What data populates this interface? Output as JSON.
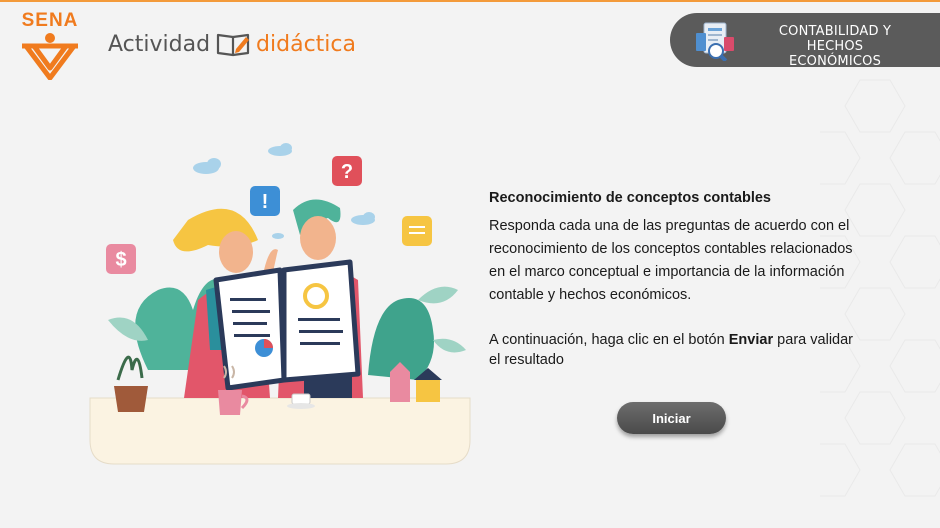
{
  "header": {
    "logo_text": "SENA",
    "brand_part1": "Actividad",
    "brand_part2": "didáctica",
    "module_title_line1": "CONTABILIDAD Y",
    "module_title_line2": "HECHOS ECONÓMICOS"
  },
  "activity": {
    "title": "Reconocimiento de conceptos contables",
    "instructions": "Responda cada una de las preguntas de acuerdo con el reconocimiento de los conceptos contables relacionados en el marco conceptual e importancia de la información contable y hechos económicos.",
    "note_prefix": "A continuación, haga clic en el botón ",
    "note_emphasis": "Enviar",
    "note_suffix": " para validar el resultado"
  },
  "start_button": {
    "label": "Iniciar"
  },
  "illustration": {
    "badges": {
      "question": "?",
      "exclamation": "!",
      "dollar": "$"
    }
  },
  "colors": {
    "accent_orange": "#f07b1e",
    "badge_gray": "#5b5b5b",
    "button_gray": "#5a5a5a"
  }
}
